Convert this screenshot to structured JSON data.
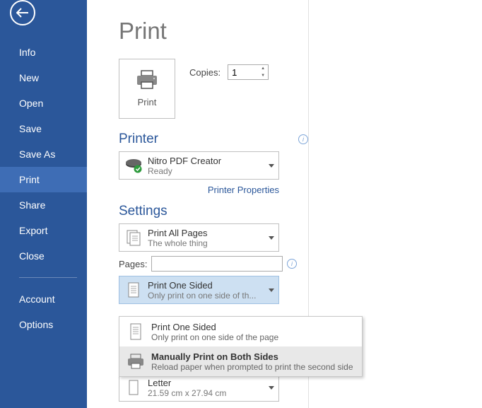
{
  "sidebar": {
    "items": [
      "Info",
      "New",
      "Open",
      "Save",
      "Save As",
      "Print",
      "Share",
      "Export",
      "Close"
    ],
    "footer": [
      "Account",
      "Options"
    ],
    "activeIndex": 5
  },
  "title": "Print",
  "printButton": {
    "label": "Print"
  },
  "copies": {
    "label": "Copies:",
    "value": "1"
  },
  "printerSection": {
    "heading": "Printer"
  },
  "printer": {
    "name": "Nitro PDF Creator",
    "status": "Ready",
    "propertiesLink": "Printer Properties"
  },
  "settingsSection": {
    "heading": "Settings"
  },
  "printAll": {
    "title": "Print All Pages",
    "sub": "The whole thing"
  },
  "pages": {
    "label": "Pages:",
    "value": ""
  },
  "oneSided": {
    "title": "Print One Sided",
    "sub": "Only print on one side of th..."
  },
  "letter": {
    "title": "Letter",
    "sub": "21.59 cm x 27.94 cm"
  },
  "ddMenu": {
    "opt1": {
      "title": "Print One Sided",
      "sub": "Only print on one side of the page"
    },
    "opt2": {
      "title": "Manually Print on Both Sides",
      "sub": "Reload paper when prompted to print the second side"
    }
  }
}
